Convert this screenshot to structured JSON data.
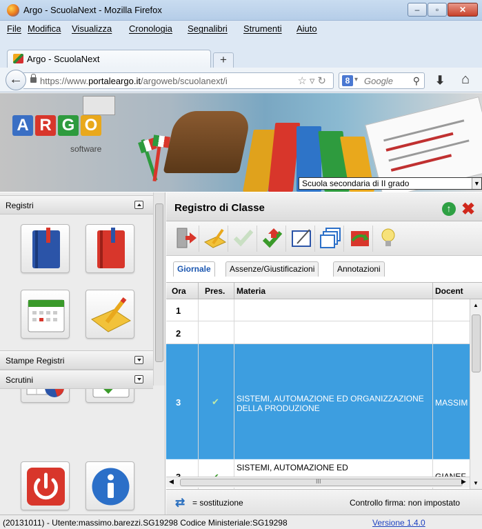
{
  "window": {
    "title": "Argo - ScuolaNext - Mozilla Firefox"
  },
  "menu": [
    "File",
    "Modifica",
    "Visualizza",
    "Cronologia",
    "Segnalibri",
    "Strumenti",
    "Aiuto"
  ],
  "browser_tab": {
    "label": "Argo - ScuolaNext",
    "new_tab": "+"
  },
  "urlbar": {
    "prefix": "https://www.",
    "domain": "portaleargo.it",
    "path": "/argoweb/scuolanext/i"
  },
  "search": {
    "engine": "8",
    "placeholder": "Google"
  },
  "banner": {
    "logo_letters": [
      "A",
      "R",
      "G",
      "O"
    ],
    "logo_colors": [
      "#3a6fc4",
      "#d8362b",
      "#2e9b3e",
      "#e9a81c"
    ],
    "logo_sub": "software",
    "school_type": "Scuola secondaria di II grado"
  },
  "left": {
    "sections": [
      "Registri",
      "Stampe Registri",
      "Scrutini"
    ],
    "icons_registri": [
      "blue-register-icon",
      "red-register-icon",
      "calendar-icon",
      "notepad-pencil-icon",
      "spreadsheet-chart-icon",
      "calendar-check-icon"
    ],
    "icons_scrutini": [
      "power-icon",
      "info-icon"
    ]
  },
  "main": {
    "title": "Registro di Classe",
    "subtabs": [
      "Giornale",
      "Assenze/Giustificazioni",
      "Annotazioni"
    ],
    "columns": [
      "Ora",
      "Pres.",
      "Materia",
      "Docent"
    ],
    "rows": [
      {
        "ora": "1",
        "pres": "",
        "materia": "",
        "docente": ""
      },
      {
        "ora": "2",
        "pres": "",
        "materia": "",
        "docente": ""
      },
      {
        "ora": "3",
        "pres": "✔",
        "materia": "SISTEMI, AUTOMAZIONE ED ORGANIZZAZIONE DELLA PRODUZIONE",
        "docente": "MASSIM"
      },
      {
        "ora": "3",
        "pres": "✔",
        "materia": "SISTEMI, AUTOMAZIONE ED",
        "docente": "GIANEF"
      }
    ],
    "legend": "= sostituzione",
    "firma": "Controllo firma: non impostato",
    "scroll_mark": "III"
  },
  "status": {
    "text": "(20131011) - Utente:massimo.barezzi.SG19298 Codice Ministeriale:SG19298",
    "version": "Versione 1.4.0"
  }
}
